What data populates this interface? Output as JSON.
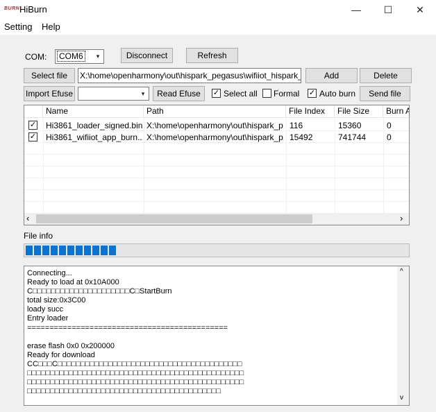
{
  "window": {
    "logo_text": "BURN",
    "title": "HiBurn",
    "minimize": "—",
    "maximize": "☐",
    "close": "✕"
  },
  "menu": [
    "Setting",
    "Help"
  ],
  "com": {
    "label": "COM:",
    "value": "COM6",
    "disconnect": "Disconnect",
    "refresh": "Refresh"
  },
  "file": {
    "select_label": "Select file",
    "path": "X:\\home\\openharmony\\out\\hispark_pegasus\\wifiiot_hispark_pega",
    "add": "Add",
    "delete": "Delete"
  },
  "efuse": {
    "import_label": "Import Efuse",
    "value": "",
    "read": "Read Efuse"
  },
  "options": {
    "select_all": {
      "label": "Select all",
      "checked": true
    },
    "formal": {
      "label": "Formal",
      "checked": false
    },
    "auto_burn": {
      "label": "Auto burn",
      "checked": true
    },
    "send_file": "Send file"
  },
  "table": {
    "columns": [
      "Name",
      "Path",
      "File Index",
      "File Size",
      "Burn A"
    ],
    "rows": [
      {
        "checked": true,
        "name": "Hi3861_loader_signed.bin",
        "path": "X:\\home\\openharmony\\out\\hispark_p...",
        "index": "116",
        "size": "15360",
        "burn": "0"
      },
      {
        "checked": true,
        "name": "Hi3861_wifiiot_app_burn....",
        "path": "X:\\home\\openharmony\\out\\hispark_p...",
        "index": "15492",
        "size": "741744",
        "burn": "0"
      }
    ]
  },
  "file_info": {
    "label": "File info",
    "progress_segments": 11,
    "progress_fraction": 0.26
  },
  "log": {
    "text": "Connecting...\nReady to load at 0x10A000\nC□□□□□□□□□□□□□□□□□□□□□C□StartBurn\ntotal size:0x3C00\nloady succ\nEntry loader\n=============================================\n\nerase flash 0x0 0x200000\nReady for download\nCC□□□C□□□□□□□□□□□□□□□□□□□□□□□□□□□□□□□□□□□□□□□□\n□□□□□□□□□□□□□□□□□□□□□□□□□□□□□□□□□□□□□□□□□□□□□□□\n□□□□□□□□□□□□□□□□□□□□□□□□□□□□□□□□□□□□□□□□□□□□□□□\n□□□□□□□□□□□□□□□□□□□□□□□□□□□□□□□□□□□□□□□□□□"
  },
  "icons": {
    "check": "✓",
    "dropdown": "▾",
    "scroll_left": "‹",
    "scroll_right": "›",
    "scroll_up": "^",
    "scroll_down": "v"
  }
}
